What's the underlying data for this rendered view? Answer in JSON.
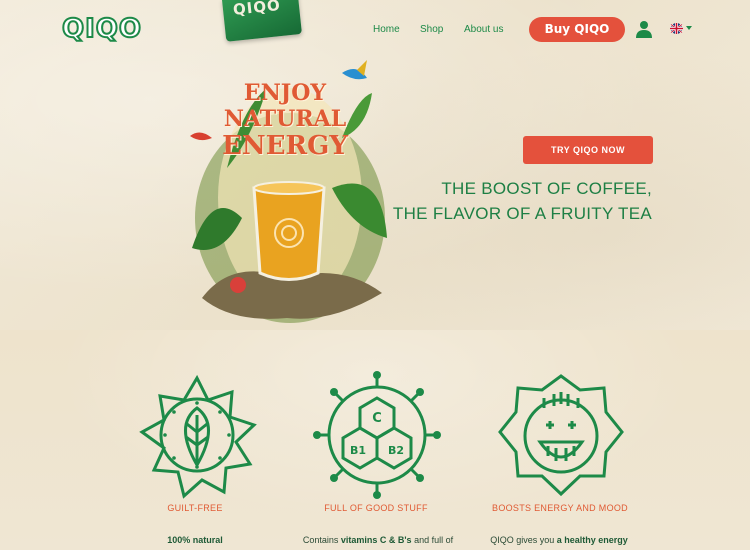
{
  "header": {
    "logo": "QIQO",
    "product_pack_label": "QIQO",
    "nav": [
      "Home",
      "Shop",
      "About us"
    ],
    "buy_button": "Buy QIQO",
    "icons": [
      "user-icon",
      "uk-flag-icon",
      "chevron-down-icon"
    ]
  },
  "hero": {
    "title_line1": "ENJOY",
    "title_line2": "NATURAL",
    "title_line3": "ENERGY",
    "cta": "TRY QIQO NOW",
    "tagline_line1": "THE BOOST OF COFFEE,",
    "tagline_line2": "THE FLAVOR OF A FRUITY TEA"
  },
  "features": [
    {
      "title": "GUILT-FREE",
      "desc_prefix": "",
      "desc_bold": "100% natural",
      "desc_suffix": "",
      "icon": "leaf-sun-icon"
    },
    {
      "title": "FULL OF GOOD STUFF",
      "desc_prefix": "Contains ",
      "desc_bold": "vitamins C & B's",
      "desc_suffix": " and full of",
      "icon": "vitamin-molecule-icon",
      "icon_labels": [
        "C",
        "B1",
        "B2"
      ]
    },
    {
      "title": "BOOSTS ENERGY AND MOOD",
      "desc_prefix": "QIQO gives you ",
      "desc_bold": "a healthy energy",
      "desc_suffix": "",
      "icon": "smiling-sun-face-icon"
    }
  ],
  "colors": {
    "brand_green": "#1d8a48",
    "accent_red": "#e4513c",
    "title_orange": "#e05a34",
    "paper": "#efe6d2"
  }
}
